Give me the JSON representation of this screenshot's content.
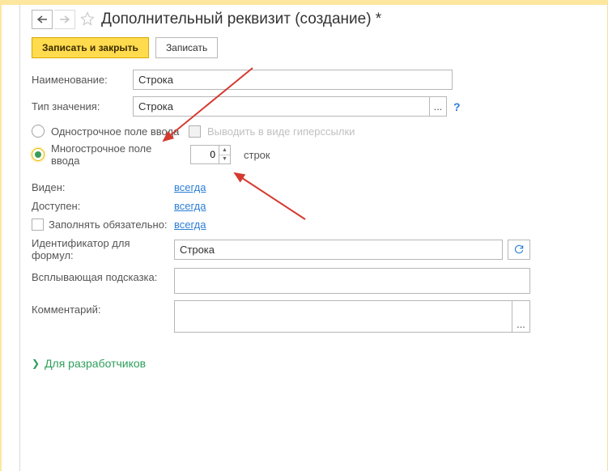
{
  "header": {
    "title": "Дополнительный реквизит (создание) *"
  },
  "toolbar": {
    "save_close": "Записать и закрыть",
    "save": "Записать"
  },
  "fields": {
    "name_label": "Наименование:",
    "name_value": "Строка",
    "type_label": "Тип значения:",
    "type_value": "Строка",
    "type_more": "...",
    "help": "?"
  },
  "radio": {
    "single": "Однострочное поле ввода",
    "hyperlink_checkbox": "Выводить в виде гиперссылки",
    "multi": "Многострочное поле ввода",
    "rows_value": "0",
    "rows_suffix": "строк"
  },
  "visibility": {
    "visible_label": "Виден:",
    "visible_value": "всегда",
    "available_label": "Доступен:",
    "available_value": "всегда",
    "mandatory_label": "Заполнять обязательно:",
    "mandatory_value": "всегда"
  },
  "formula": {
    "label": "Идентификатор для формул:",
    "value": "Строка"
  },
  "tooltip": {
    "label": "Всплывающая подсказка:",
    "value": ""
  },
  "comment": {
    "label": "Комментарий:",
    "value": "",
    "more": "..."
  },
  "dev_link": "Для разработчиков"
}
